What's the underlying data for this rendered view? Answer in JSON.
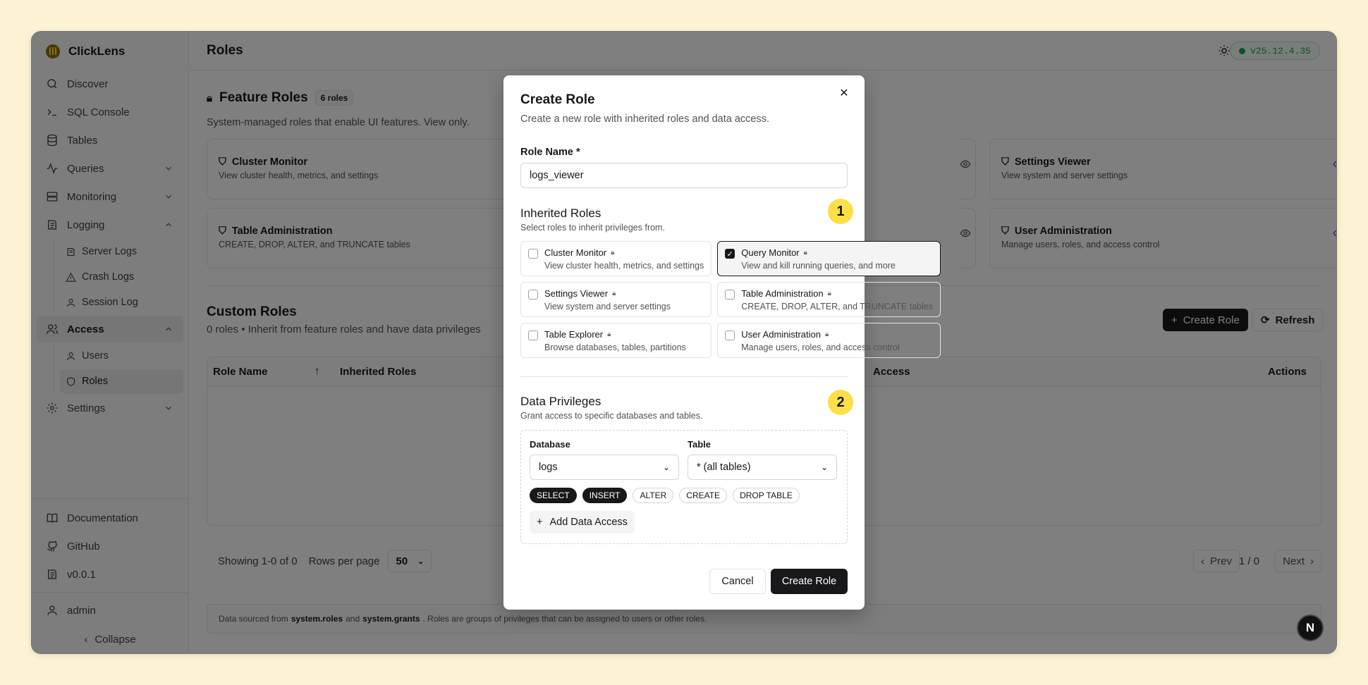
{
  "app": {
    "name": "ClickLens",
    "version_badge": "v25.12.4.35"
  },
  "sidebar": {
    "items": [
      {
        "label": "Discover"
      },
      {
        "label": "SQL Console"
      },
      {
        "label": "Tables"
      },
      {
        "label": "Queries"
      },
      {
        "label": "Monitoring"
      },
      {
        "label": "Logging"
      }
    ],
    "logging_sub": [
      {
        "label": "Server Logs"
      },
      {
        "label": "Crash Logs"
      },
      {
        "label": "Session Log"
      }
    ],
    "access": {
      "label": "Access"
    },
    "access_sub": [
      {
        "label": "Users"
      },
      {
        "label": "Roles"
      }
    ],
    "settings": {
      "label": "Settings"
    },
    "bottom": [
      {
        "label": "Documentation"
      },
      {
        "label": "GitHub"
      },
      {
        "label": "v0.0.1"
      }
    ],
    "user": "admin",
    "collapse": "Collapse"
  },
  "header": {
    "title": "Roles"
  },
  "feature_roles": {
    "title": "Feature Roles",
    "count": "6 roles",
    "description": "System-managed roles that enable UI features. View only.",
    "cards": [
      {
        "title": "Cluster Monitor",
        "desc": "View cluster health, metrics, and settings"
      },
      {
        "title": "Settings Viewer",
        "desc": "View system and server settings"
      },
      {
        "title": "Table Administration",
        "desc": "CREATE, DROP, ALTER, and TRUNCATE tables"
      },
      {
        "title": "User Administration",
        "desc": "Manage users, roles, and access control"
      }
    ]
  },
  "custom_roles": {
    "title": "Custom Roles",
    "description": "0 roles • Inherit from feature roles and have data privileges",
    "create_button": "Create Role",
    "refresh_button": "Refresh",
    "columns": {
      "role_name": "Role Name",
      "inherited": "Inherited Roles",
      "access": "Access",
      "actions": "Actions"
    }
  },
  "pagination": {
    "showing": "Showing 1-0 of 0",
    "rows_per_page": "Rows per page",
    "page_size": "50",
    "prev": "Prev",
    "page": "1 / 0",
    "next": "Next"
  },
  "footer": {
    "pre": "Data sourced from",
    "t1": "system.roles",
    "mid": "and",
    "t2": "system.grants",
    "post": ". Roles are groups of privileges that can be assigned to users or other roles."
  },
  "modal": {
    "title": "Create Role",
    "subtitle": "Create a new role with inherited roles and data access.",
    "role_name_label": "Role Name *",
    "role_name_value": "logs_viewer",
    "inherited_title": "Inherited Roles",
    "inherited_hint": "Select roles to inherit privileges from.",
    "step1": "1",
    "roles": [
      {
        "name": "Cluster Monitor",
        "desc": "View cluster health, metrics, and settings",
        "checked": false
      },
      {
        "name": "Query Monitor",
        "desc": "View and kill running queries, and more",
        "checked": true
      },
      {
        "name": "Settings Viewer",
        "desc": "View system and server settings",
        "checked": false
      },
      {
        "name": "Table Administration",
        "desc": "CREATE, DROP, ALTER, and TRUNCATE tables",
        "checked": false
      },
      {
        "name": "Table Explorer",
        "desc": "Browse databases, tables, partitions",
        "checked": false
      },
      {
        "name": "User Administration",
        "desc": "Manage users, roles, and access control",
        "checked": false
      }
    ],
    "privileges_title": "Data Privileges",
    "privileges_hint": "Grant access to specific databases and tables.",
    "step2": "2",
    "database_label": "Database",
    "database_value": "logs",
    "table_label": "Table",
    "table_value": "* (all tables)",
    "privilege_chips": [
      {
        "label": "SELECT",
        "on": true
      },
      {
        "label": "INSERT",
        "on": true
      },
      {
        "label": "ALTER",
        "on": false
      },
      {
        "label": "CREATE",
        "on": false
      },
      {
        "label": "DROP TABLE",
        "on": false
      }
    ],
    "add_data_access": "Add Data Access",
    "cancel": "Cancel",
    "submit": "Create Role"
  },
  "floating": {
    "label": "N"
  }
}
